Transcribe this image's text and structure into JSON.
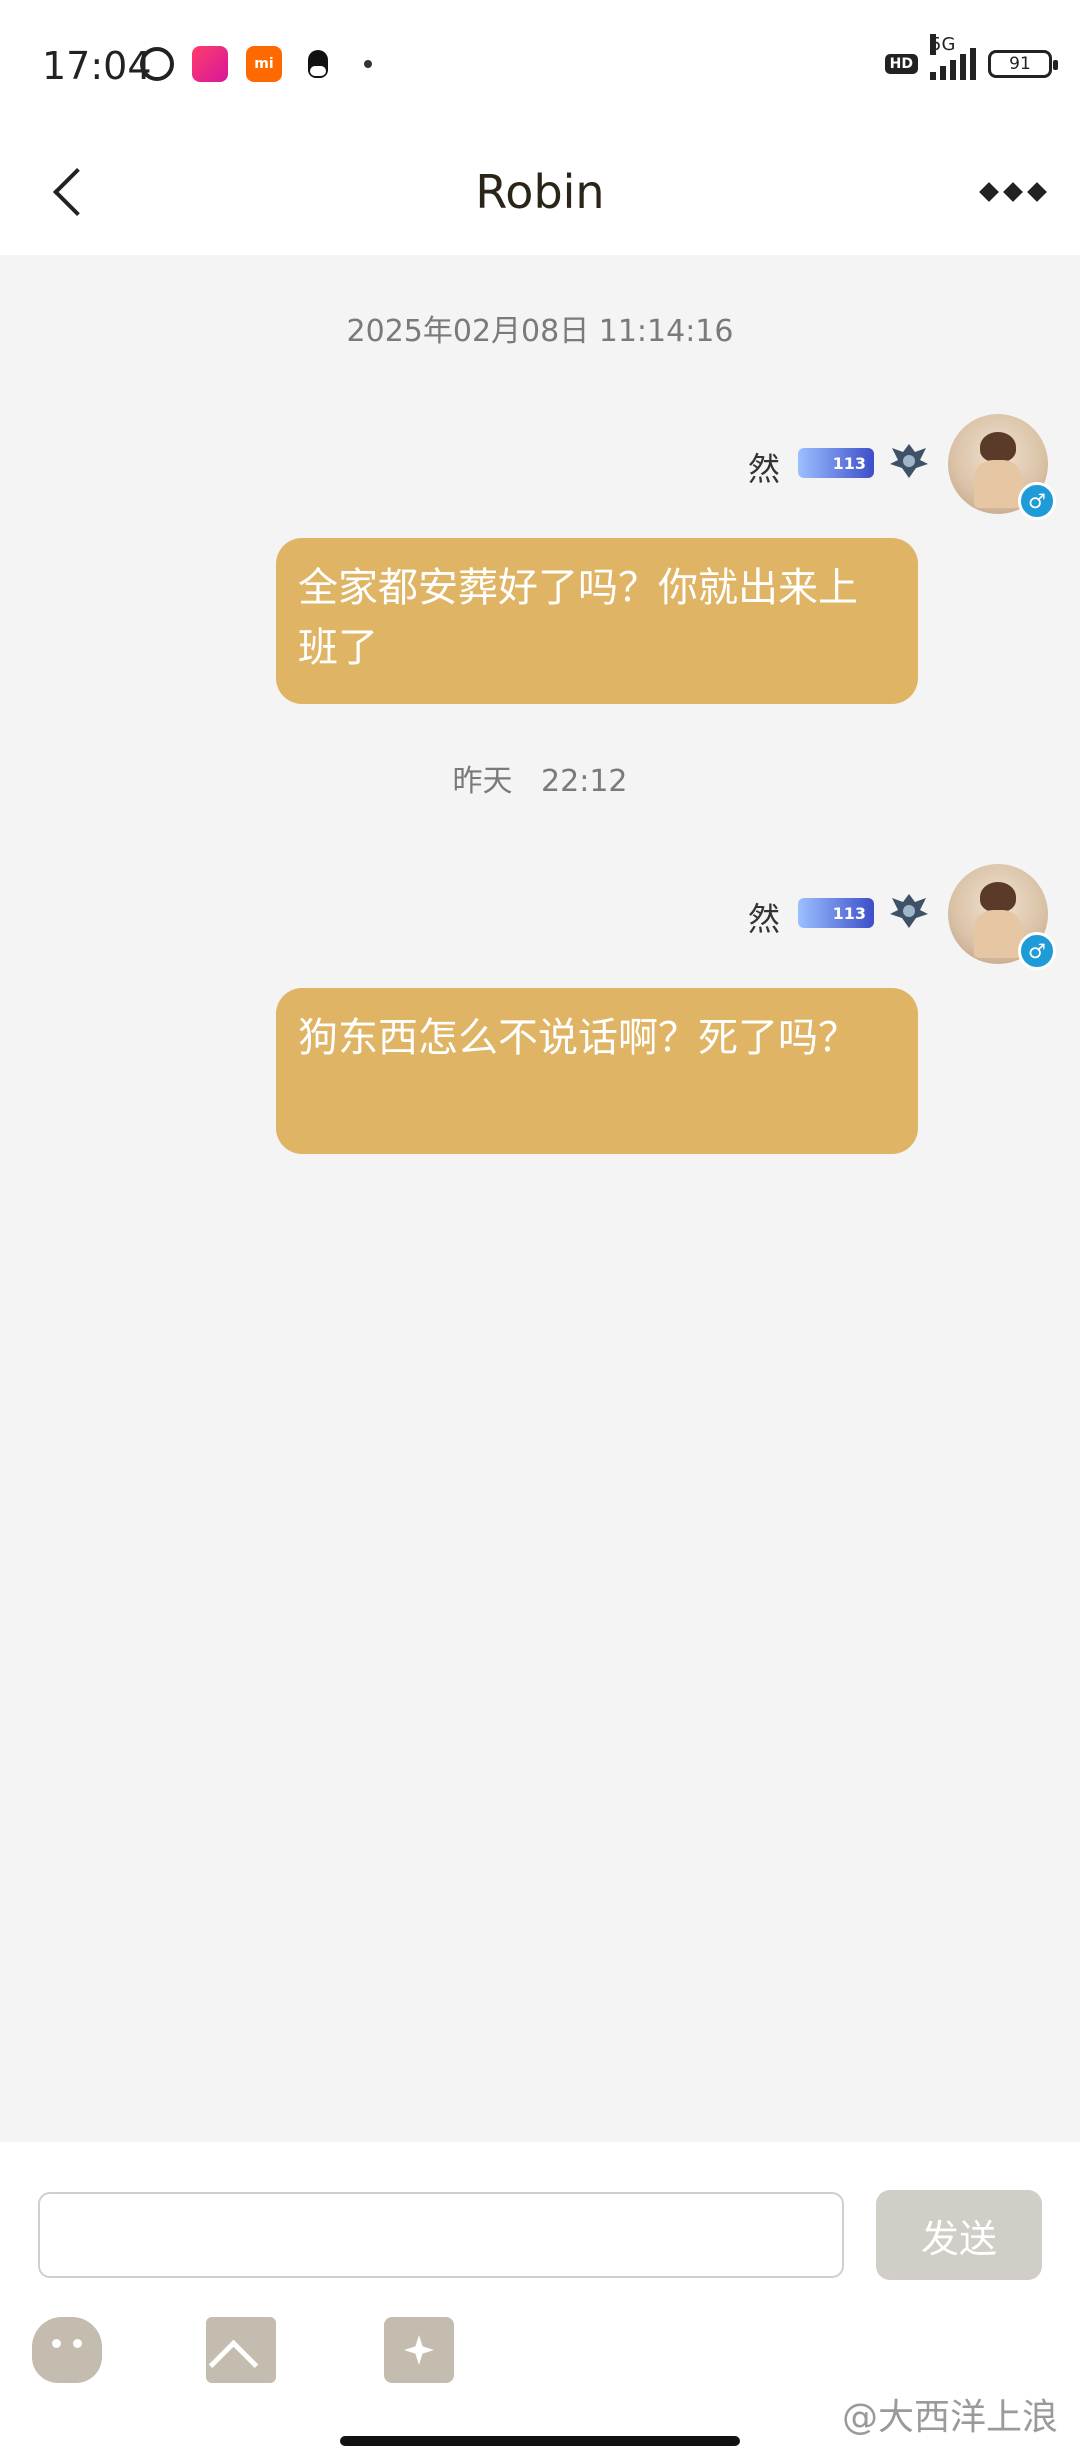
{
  "status_bar": {
    "time": "17:04",
    "hd": "HD",
    "network": "5G",
    "battery": "91",
    "icons": [
      "alarm-clock-icon",
      "app-notification-icon",
      "mi-icon",
      "qq-icon",
      "dot-icon"
    ]
  },
  "header": {
    "title": "Robin",
    "back_icon": "chevron-left-icon",
    "more_icon": "more-diamonds-icon"
  },
  "messages": [
    {
      "timestamp": "2025年02月08日 11:14:16",
      "sender_name": "然",
      "rank_badge": "113",
      "text": "全家都安葬好了吗？你就出来上班了"
    },
    {
      "timestamp": "昨天   22:12",
      "sender_name": "然",
      "rank_badge": "113",
      "text": "狗东西怎么不说话啊？死了吗？"
    }
  ],
  "composer": {
    "input_value": "",
    "send_label": "发送",
    "tools": [
      "emoji-icon",
      "image-icon",
      "camera-icon"
    ]
  },
  "watermark": "@大西洋上浪",
  "colors": {
    "bubble": "#dfb464",
    "background": "#f4f4f4",
    "send_button": "#d1cdc7",
    "gender_badge": "#1f9bd7"
  }
}
